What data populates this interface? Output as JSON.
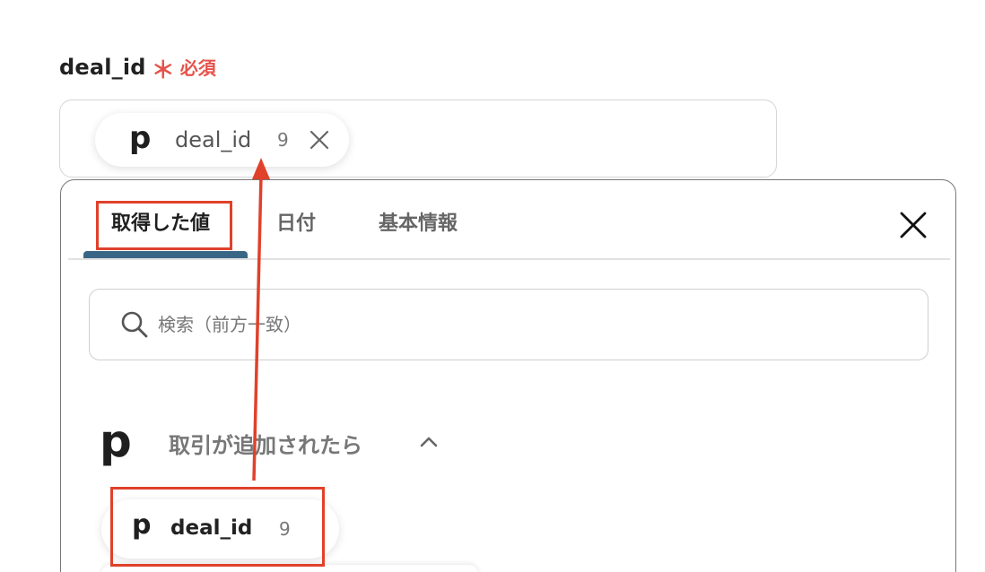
{
  "field": {
    "name": "deal_id",
    "required_mark": "＊",
    "required_text": "必須"
  },
  "selected_chip": {
    "icon": "pipedrive-p-logo",
    "logo_char": "p",
    "name": "deal_id",
    "count": "9"
  },
  "panel": {
    "tabs": [
      {
        "label": "取得した値",
        "active": true
      },
      {
        "label": "日付",
        "active": false
      },
      {
        "label": "基本情報",
        "active": false
      }
    ],
    "search": {
      "placeholder": "検索（前方一致）",
      "value": ""
    },
    "group": {
      "logo_char": "p",
      "trigger_label": "取引が追加されたら",
      "expanded": true
    },
    "items": [
      {
        "logo_char": "p",
        "name": "deal_id",
        "count": "9"
      }
    ]
  },
  "colors": {
    "accent": "#3a6686",
    "required": "#e5534b",
    "annotation": "#e0412b"
  }
}
